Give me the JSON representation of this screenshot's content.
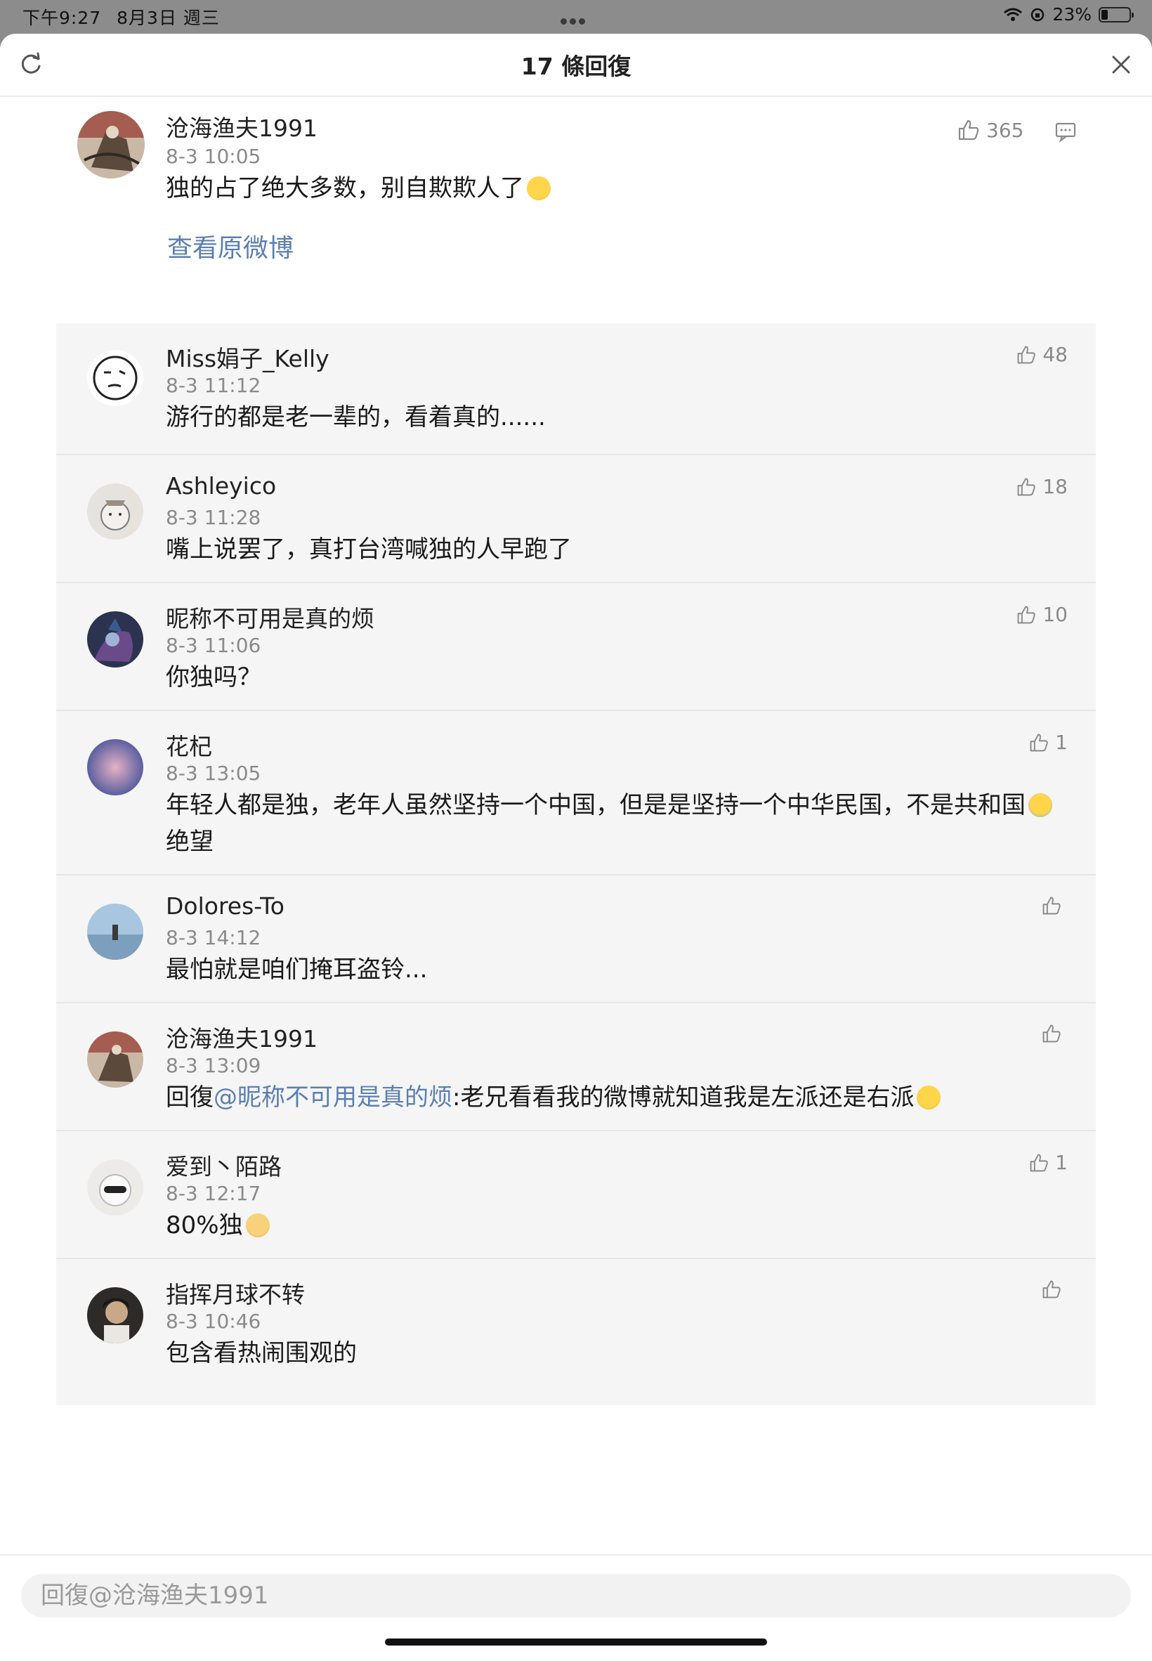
{
  "status_bar": {
    "time": "下午9:27",
    "date": "8月3日 週三",
    "battery": "23%",
    "battery_level": 0.23
  },
  "header": {
    "title": "17 條回復"
  },
  "main_comment": {
    "username": "沧海渔夫1991",
    "time": "8-3 10:05",
    "text": "独的占了绝大多数，别自欺欺人了",
    "emoji": "sweat-emoji",
    "likes": "365",
    "view_original": "查看原微博"
  },
  "replies": [
    {
      "username": "Miss娟子_Kelly",
      "time": "8-3 11:12",
      "text": "游行的都是老一辈的，看着真的......",
      "likes": "48"
    },
    {
      "username": "Ashleyico",
      "time": "8-3 11:28",
      "text": "嘴上说罢了，真打台湾喊独的人早跑了",
      "likes": "18"
    },
    {
      "username": "昵称不可用是真的烦",
      "time": "8-3 11:06",
      "text": "你独吗？",
      "likes": "10"
    },
    {
      "username": "花杞",
      "time": "8-3 13:05",
      "text": "年轻人都是独，老年人虽然坚持一个中国，但是是坚持一个中华民国，不是共和国",
      "text_after": "绝望",
      "emoji": "crying-emoji",
      "likes": "1"
    },
    {
      "username": "Dolores-To",
      "time": "8-3 14:12",
      "text": "最怕就是咱们掩耳盗铃...",
      "likes": ""
    },
    {
      "username": "沧海渔夫1991",
      "time": "8-3 13:09",
      "reply_prefix": "回復",
      "mention": "@昵称不可用是真的烦",
      "text": ":老兄看看我的微博就知道我是左派还是右派",
      "emoji": "glasses-emoji",
      "likes": ""
    },
    {
      "username": "爱到丶陌路",
      "time": "8-3 12:17",
      "text": "80%独",
      "emoji": "doge-emoji",
      "likes": "1"
    },
    {
      "username": "指挥月球不转",
      "time": "8-3 10:46",
      "text": "包含看热闹围观的",
      "likes": ""
    }
  ],
  "input": {
    "placeholder": "回復@沧海渔夫1991"
  },
  "colors": {
    "link": "#5b7fb0",
    "panel": "#f5f5f5",
    "muted": "#8a8a8a"
  }
}
